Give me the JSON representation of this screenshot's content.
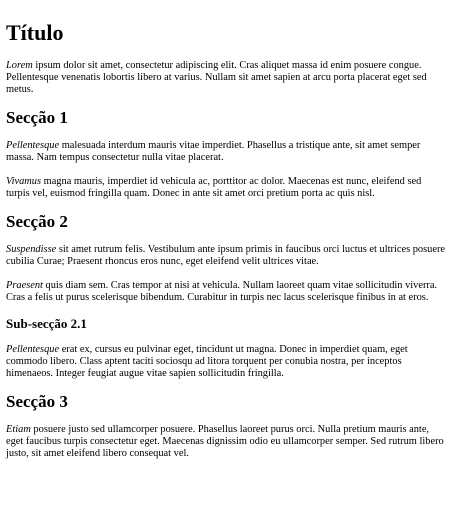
{
  "document": {
    "title": "Título",
    "intro": {
      "lead": "Lorem",
      "text": " ipsum dolor sit amet, consectetur adipiscing elit. Cras aliquet massa id enim posuere congue. Pellentesque venenatis lobortis libero at varius. Nullam sit amet sapien at arcu porta placerat eget sed metus."
    },
    "sections": [
      {
        "heading": "Secção 1",
        "paragraphs": [
          {
            "lead": "Pellentesque",
            "text": " malesuada interdum mauris vitae imperdiet. Phasellus a tristique ante, sit amet semper massa. Nam tempus consectetur nulla vitae placerat."
          },
          {
            "lead": "Vivamus",
            "text": " magna mauris, imperdiet id vehicula ac, porttitor ac dolor. Maecenas est nunc, eleifend sed turpis vel, euismod fringilla quam. Donec in ante sit amet orci pretium porta ac quis nisl."
          }
        ]
      },
      {
        "heading": "Secção 2",
        "paragraphs": [
          {
            "lead": "Suspendisse",
            "text": " sit amet rutrum felis. Vestibulum ante ipsum primis in faucibus orci luctus et ultrices posuere cubilia Curae; Praesent rhoncus eros nunc, eget eleifend velit ultrices vitae."
          },
          {
            "lead": "Praesent",
            "text": " quis diam sem. Cras tempor at nisi at vehicula. Nullam laoreet quam vitae sollicitudin viverra. Cras a felis ut purus scelerisque bibendum. Curabitur in turpis nec lacus scelerisque finibus in at eros."
          }
        ],
        "subsection": {
          "heading": "Sub-secção 2.1",
          "paragraphs": [
            {
              "lead": "Pellentesque",
              "text": " erat ex, cursus eu pulvinar eget, tincidunt ut magna. Donec in imperdiet quam, eget commodo libero. Class aptent taciti sociosqu ad litora torquent per conubia nostra, per inceptos himenaeos. Integer feugiat augue vitae sapien sollicitudin fringilla."
            }
          ]
        }
      },
      {
        "heading": "Secção 3",
        "paragraphs": [
          {
            "lead": "Etiam",
            "text": " posuere justo sed ullamcorper posuere. Phasellus laoreet purus orci. Nulla pretium mauris ante, eget faucibus turpis consectetur eget. Maecenas dignissim odio eu ullamcorper semper. Sed rutrum libero justo, sit amet eleifend libero consequat vel."
          }
        ]
      }
    ]
  }
}
